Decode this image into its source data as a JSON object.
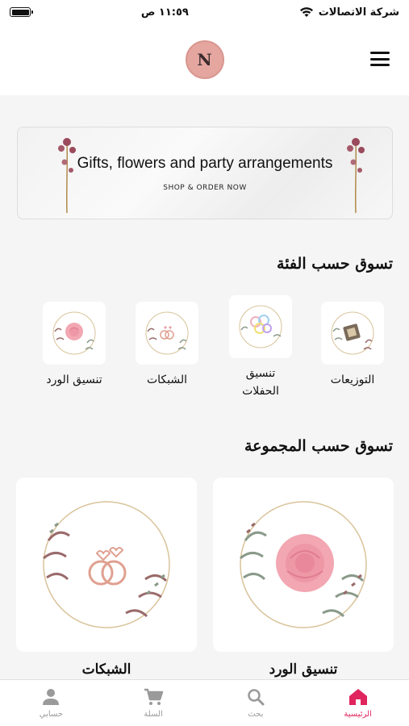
{
  "status_bar": {
    "carrier": "شركة الاتصالات",
    "time": "١١:٥٩ ص"
  },
  "header": {
    "logo_letter": "N"
  },
  "banner": {
    "title": "Gifts, flowers and party arrangements",
    "subtitle": "SHOP & ORDER NOW"
  },
  "categories": {
    "title": "تسوق حسب الفئة",
    "items": [
      {
        "label": "التوزيعات",
        "icon": "gift-box-icon"
      },
      {
        "label": "تنسيق\nالحفلات",
        "icon": "balloons-icon"
      },
      {
        "label": "الشبكات",
        "icon": "rings-icon"
      },
      {
        "label": "تنسيق الورد",
        "icon": "rose-icon"
      }
    ]
  },
  "collections": {
    "title": "تسوق حسب المجموعة",
    "items": [
      {
        "label": "تنسيق الورد",
        "icon": "rose-icon"
      },
      {
        "label": "الشبكات",
        "icon": "rings-icon"
      }
    ]
  },
  "tab_bar": {
    "items": [
      {
        "label": "الرئيسية",
        "icon": "home-icon",
        "active": true
      },
      {
        "label": "بحث",
        "icon": "search-icon",
        "active": false
      },
      {
        "label": "السلة",
        "icon": "cart-icon",
        "active": false
      },
      {
        "label": "حسابي",
        "icon": "person-icon",
        "active": false
      }
    ]
  },
  "colors": {
    "accent": "#e0245e",
    "logo_bg": "#e5a6a0",
    "rose": "#f2a7b2"
  }
}
